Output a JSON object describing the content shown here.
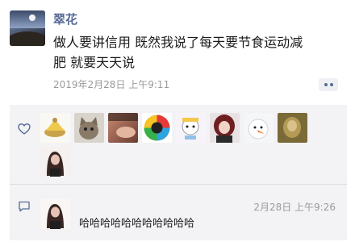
{
  "post": {
    "author": "翠花",
    "text_line1": "做人要讲信用 既然我说了每天要节食运动减",
    "text_line2": "肥 就要天天说",
    "timestamp": "2019年2月28日 上午9:11",
    "more_icon": "more-dots-icon"
  },
  "interactions": {
    "like_icon": "heart-icon",
    "comment_icon": "comment-icon",
    "likers": [
      "avatar-cake",
      "avatar-cat",
      "avatar-closeup",
      "avatar-aperture",
      "avatar-sticker",
      "avatar-redhead",
      "avatar-ghost",
      "avatar-painting",
      "avatar-woman"
    ],
    "comment": {
      "avatar": "avatar-woman",
      "time": "2月28日 上午9:26",
      "text": "哈哈哈哈哈哈哈哈哈哈哈"
    }
  },
  "colors": {
    "author_link": "#576b95",
    "meta_gray": "#9a9a9a",
    "panel_bg": "#f3f3f5"
  }
}
